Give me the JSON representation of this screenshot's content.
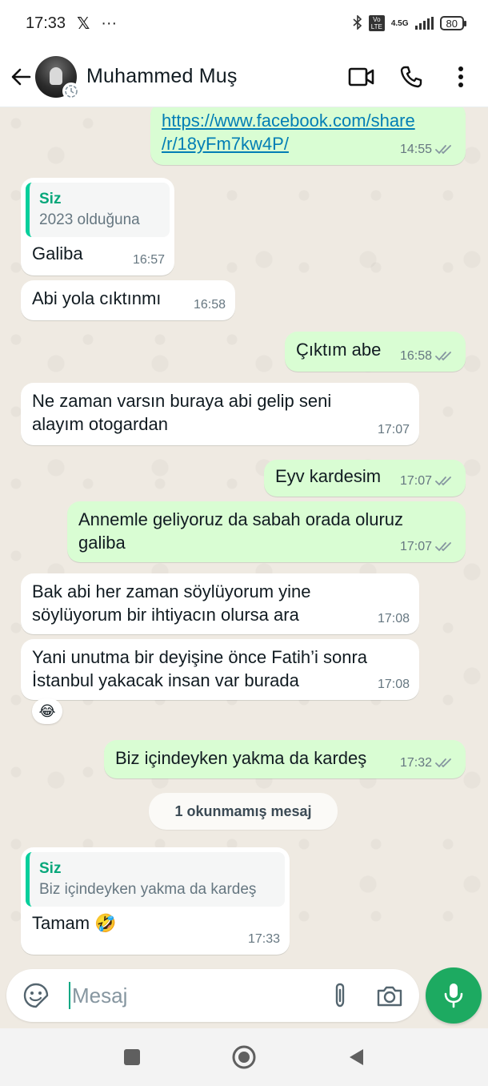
{
  "status_bar": {
    "time": "17:33",
    "x_icon": "x-logo-icon",
    "more_dots": "···",
    "network": "4.5G",
    "volte": "Vo LTE",
    "battery": "80"
  },
  "header": {
    "contact_name": "Muhammed Muş"
  },
  "messages": [
    {
      "dir": "out",
      "link_line1": "https://www.facebook.com/share",
      "link_line2": "/r/18yFm7kw4P/",
      "time": "14:55"
    },
    {
      "dir": "in",
      "quote_author": "Siz",
      "quote_text": "2023 olduğuna",
      "text": "Galiba",
      "time": "16:57"
    },
    {
      "dir": "in",
      "text": "Abi yola cıktınmı",
      "time": "16:58"
    },
    {
      "dir": "out",
      "text": "Çıktım abe",
      "time": "16:58"
    },
    {
      "dir": "in",
      "line1": "Ne zaman varsın buraya abi gelip seni",
      "line2": "alayım otogardan",
      "time": "17:07"
    },
    {
      "dir": "out",
      "text": "Eyv kardesim",
      "time": "17:07"
    },
    {
      "dir": "out",
      "line1": "Annemle geliyoruz da sabah orada oluruz",
      "line2": "galiba",
      "time": "17:07"
    },
    {
      "dir": "in",
      "line1": "Bak abi her zaman söylüyorum yine",
      "line2": "söylüyorum bir ihtiyacın olursa ara",
      "time": "17:08"
    },
    {
      "dir": "in",
      "line1": "Yani unutma bir deyişine önce Fatih’i sonra",
      "line2": "İstanbul yakacak insan var burada",
      "time": "17:08",
      "reaction": "😂"
    },
    {
      "dir": "out",
      "text": "Biz içindeyken yakma da kardeş",
      "time": "17:32"
    },
    {
      "dir": "in",
      "quote_author": "Siz",
      "quote_text": "Biz içindeyken yakma da kardeş",
      "text": "Tamam 🤣",
      "time": "17:33"
    }
  ],
  "unread_banner": "1 okunmamış mesaj",
  "composer": {
    "placeholder": "Mesaj"
  },
  "colors": {
    "chat_bg": "#efeae2",
    "incoming_bubble": "#ffffff",
    "outgoing_bubble": "#d9fdd3",
    "accent_green": "#1daa61",
    "link": "#027eb5",
    "read_ticks": "#8696a0"
  }
}
